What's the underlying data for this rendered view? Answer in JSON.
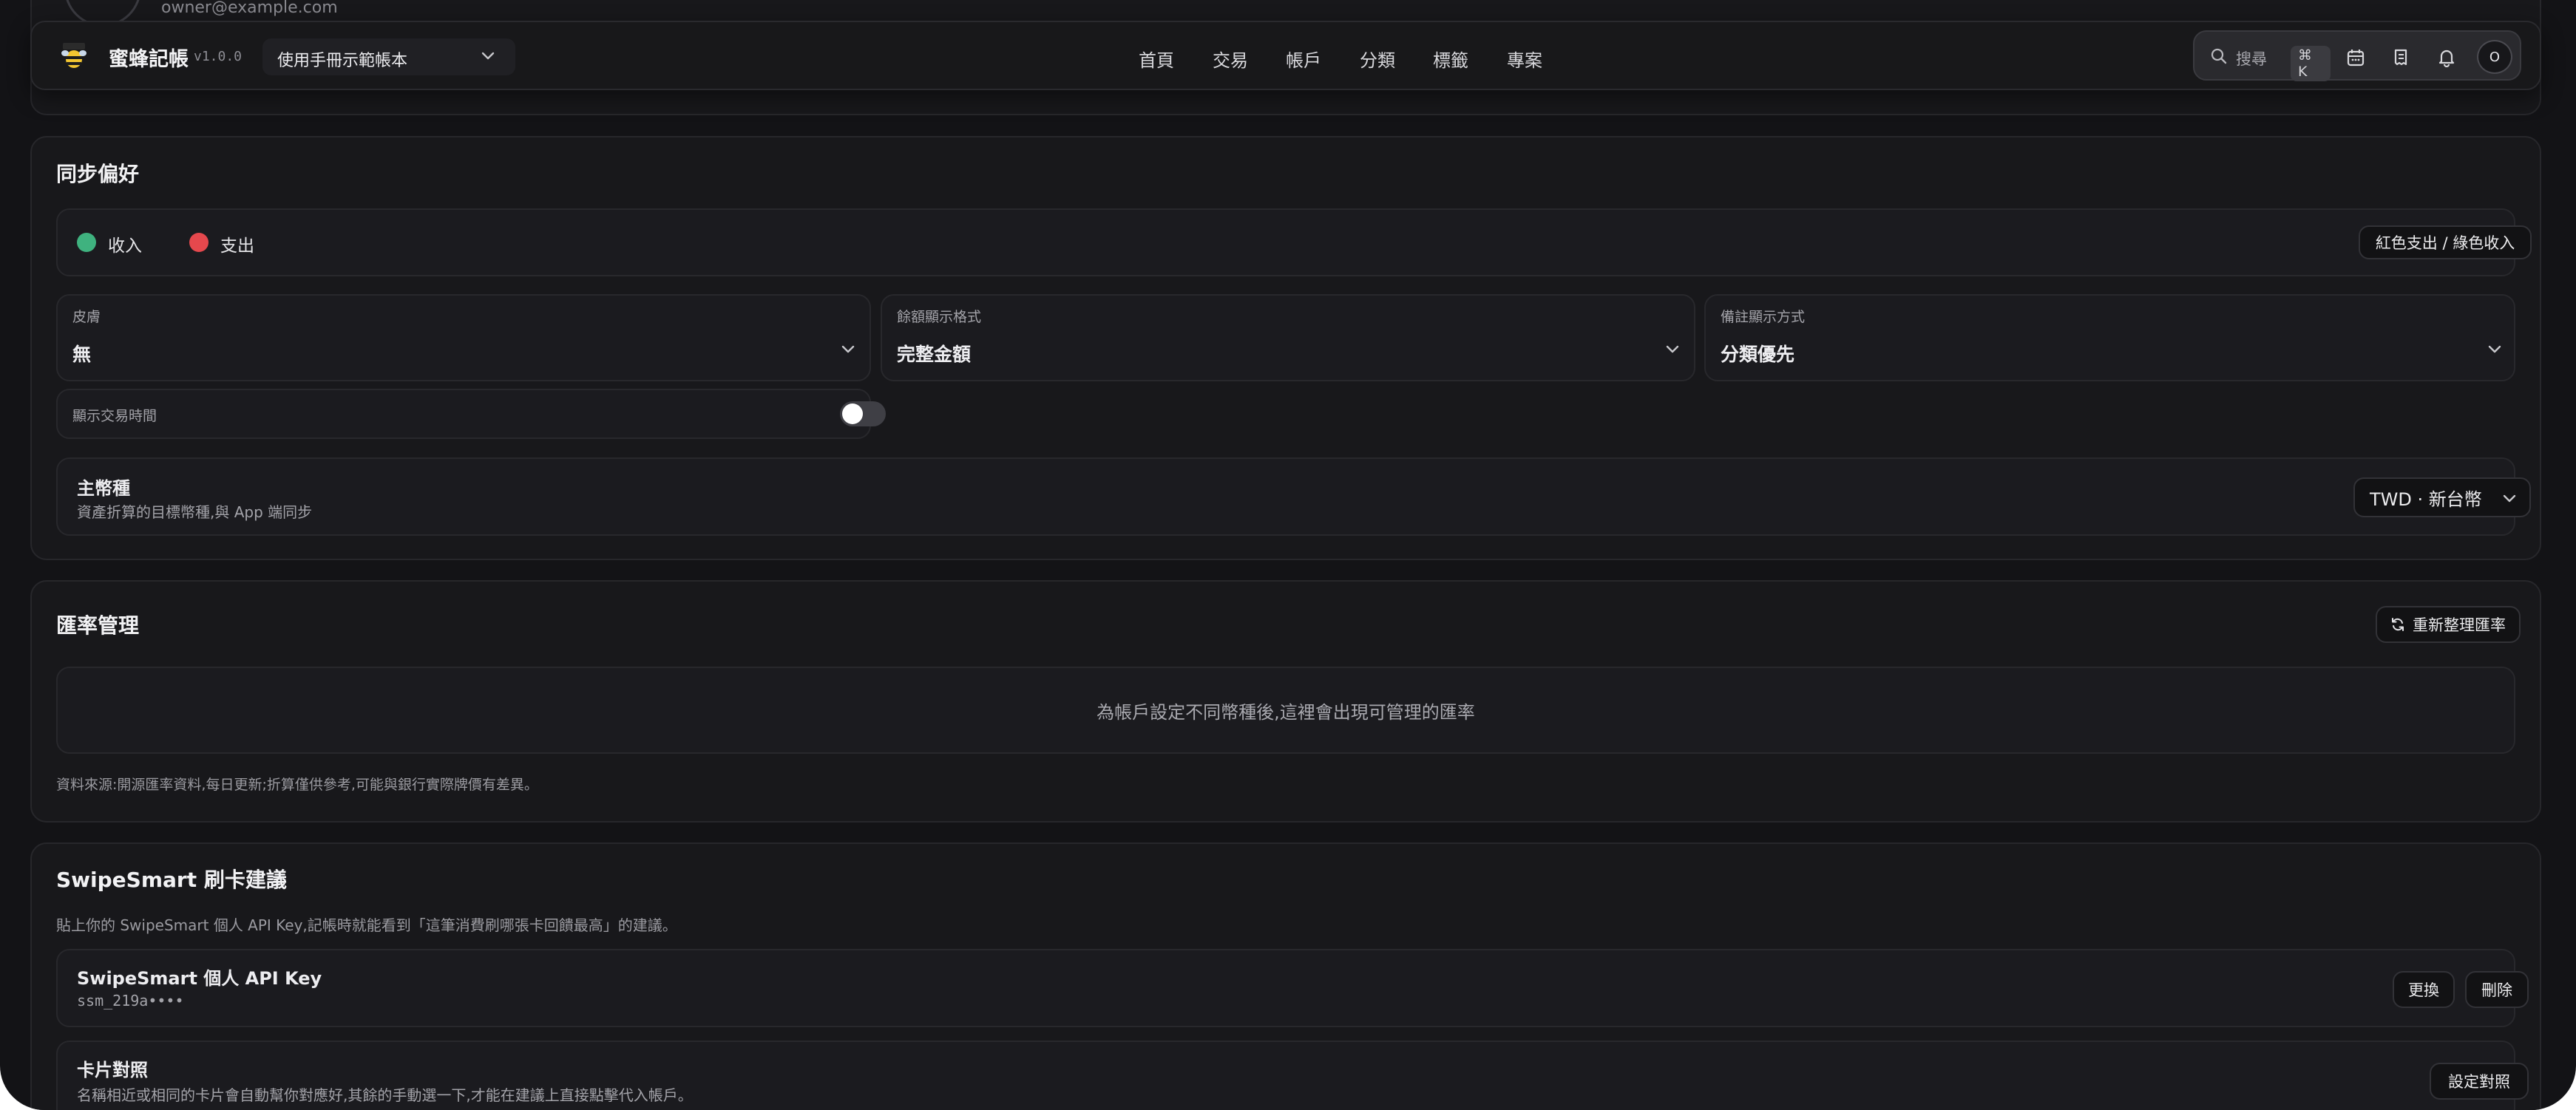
{
  "header": {
    "app_name": "蜜蜂記帳",
    "version": "v1.0.0",
    "ledger_selected": "使用手冊示範帳本",
    "behind_email": "owner@example.com",
    "nav": [
      "首頁",
      "交易",
      "帳戶",
      "分類",
      "標籤",
      "專案"
    ],
    "search_placeholder": "搜尋",
    "search_shortcut": "⌘ K",
    "avatar_initial": "O"
  },
  "sync_prefs": {
    "title": "同步偏好",
    "legend_income": "收入",
    "legend_expense": "支出",
    "color_scheme_button": "紅色支出 / 綠色收入",
    "selects": [
      {
        "label": "皮膚",
        "value": "無"
      },
      {
        "label": "餘額顯示格式",
        "value": "完整金額"
      },
      {
        "label": "備註顯示方式",
        "value": "分類優先"
      }
    ],
    "toggle_label": "顯示交易時間",
    "toggle_on": false,
    "currency_title": "主幣種",
    "currency_desc": "資產折算的目標幣種,與 App 端同步",
    "currency_value": "TWD · 新台幣"
  },
  "exchange": {
    "title": "匯率管理",
    "refresh_button": "重新整理匯率",
    "empty_message": "為帳戶設定不同幣種後,這裡會出現可管理的匯率",
    "source_note": "資料來源:開源匯率資料,每日更新;折算僅供參考,可能與銀行實際牌價有差異。"
  },
  "swipesmart": {
    "title": "SwipeSmart 刷卡建議",
    "intro": "貼上你的 SwipeSmart 個人 API Key,記帳時就能看到「這筆消費刷哪張卡回饋最高」的建議。",
    "api_key_title": "SwipeSmart 個人 API Key",
    "api_key_value": "ssm_219a••••",
    "replace_button": "更換",
    "delete_button": "刪除",
    "card_map_title": "卡片對照",
    "card_map_desc": "名稱相近或相同的卡片會自動幫你對應好,其餘的手動選一下,才能在建議上直接點擊代入帳戶。",
    "card_map_button": "設定對照"
  },
  "colors": {
    "income": "#3fb27f",
    "expense": "#e5484d",
    "background": "#131316",
    "card": "#18181b"
  }
}
